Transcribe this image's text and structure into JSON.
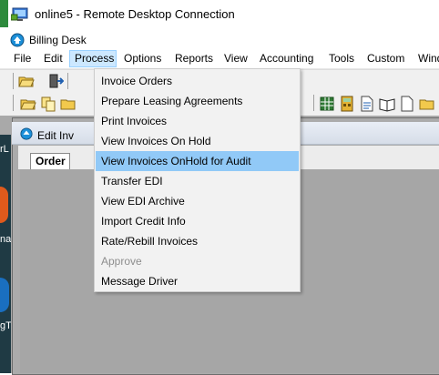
{
  "rdp": {
    "title": "online5 - Remote Desktop Connection"
  },
  "app": {
    "title": "Billing Desk"
  },
  "menubar": {
    "items": [
      {
        "label": "File"
      },
      {
        "label": "Edit"
      },
      {
        "label": "Process"
      },
      {
        "label": "Options"
      },
      {
        "label": "Reports"
      },
      {
        "label": "View"
      },
      {
        "label": "Accounting"
      },
      {
        "label": "Tools"
      },
      {
        "label": "Custom"
      },
      {
        "label": "Wind"
      }
    ],
    "active": "Process"
  },
  "process_menu": {
    "items": [
      {
        "label": "Invoice Orders",
        "state": "enabled"
      },
      {
        "label": "Prepare Leasing Agreements",
        "state": "enabled"
      },
      {
        "label": "Print Invoices",
        "state": "enabled"
      },
      {
        "label": "View Invoices On Hold",
        "state": "enabled"
      },
      {
        "label": "View Invoices OnHold for Audit",
        "state": "highlighted"
      },
      {
        "label": "Transfer EDI",
        "state": "enabled"
      },
      {
        "label": "View EDI Archive",
        "state": "enabled"
      },
      {
        "label": "Import Credit Info",
        "state": "enabled"
      },
      {
        "label": "Rate/Rebill Invoices",
        "state": "enabled"
      },
      {
        "label": "Approve",
        "state": "disabled"
      },
      {
        "label": "Message Driver",
        "state": "enabled"
      }
    ]
  },
  "child_window": {
    "title": "Edit Inv",
    "tab_label": "Order"
  },
  "left_strip": {
    "labels": [
      "rL",
      "na",
      "gT"
    ]
  },
  "colors": {
    "menu_highlight": "#91c9f7",
    "menubar_active": "#cce8ff",
    "disabled_text": "#8e8e8e",
    "workspace": "#a9a9a9"
  }
}
